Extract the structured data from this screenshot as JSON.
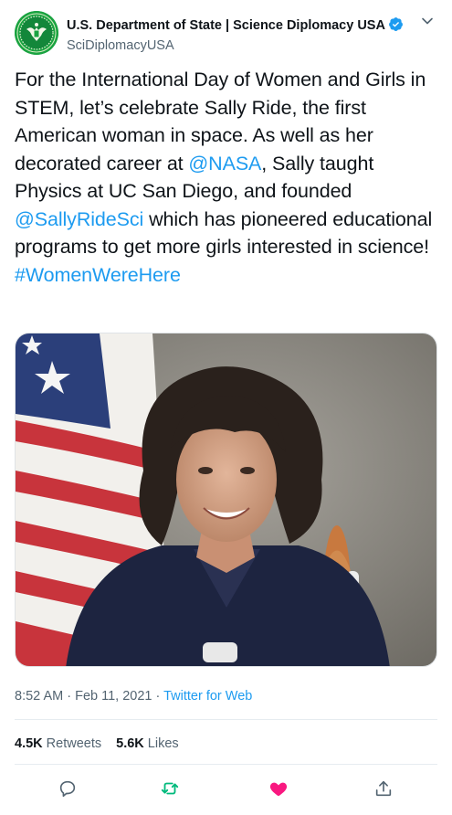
{
  "account": {
    "display_name": "U.S. Department of State | Science Diplomacy USA",
    "handle": "SciDiplomacyUSA",
    "verified_icon": "verified-badge-icon",
    "avatar": "state-department-seal-avatar"
  },
  "tweet": {
    "text_part1": "For the International Day of Women and Girls in STEM, let’s celebrate Sally Ride, the first American woman in space. As well as her decorated career at ",
    "mention1": "@NASA",
    "text_part2": ", Sally taught Physics at UC San Diego, and founded ",
    "mention2": "@SallyRideSci",
    "text_part3": " which has pioneered educational programs to get more girls interested in science!",
    "hashtag": "#WomenWereHere",
    "media": "Portrait photo of astronaut in front of American flag and shuttle model"
  },
  "meta": {
    "time": "8:52 AM",
    "separator": " · ",
    "date": "Feb 11, 2021",
    "source": "Twitter for Web"
  },
  "stats": {
    "retweets_count": "4.5K",
    "retweets_label": "Retweets",
    "likes_count": "5.6K",
    "likes_label": "Likes"
  },
  "colors": {
    "link": "#1d9bf0",
    "like": "#f91880",
    "retweet": "#00ba7c",
    "secondary": "#536471"
  }
}
